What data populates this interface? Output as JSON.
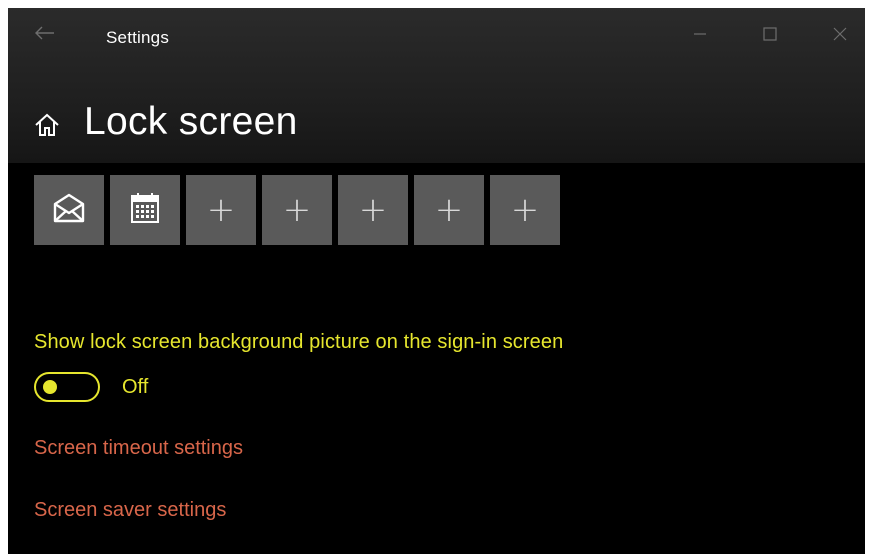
{
  "titlebar": {
    "title": "Settings",
    "back_icon": "arrow-left-icon",
    "minimize_icon": "minimize-icon",
    "maximize_icon": "maximize-icon",
    "close_icon": "close-icon"
  },
  "page": {
    "title": "Lock screen",
    "home_icon": "home-icon"
  },
  "quick_status": {
    "tiles": [
      {
        "icon": "mail-icon"
      },
      {
        "icon": "calendar-icon"
      },
      {
        "icon": "plus-icon",
        "label": "+"
      },
      {
        "icon": "plus-icon",
        "label": "+"
      },
      {
        "icon": "plus-icon",
        "label": "+"
      },
      {
        "icon": "plus-icon",
        "label": "+"
      },
      {
        "icon": "plus-icon",
        "label": "+"
      }
    ]
  },
  "signin_background": {
    "label": "Show lock screen background picture on the sign-in screen",
    "state": "Off",
    "enabled": false
  },
  "links": {
    "screen_timeout": "Screen timeout settings",
    "screen_saver": "Screen saver settings"
  },
  "colors": {
    "background": "#000000",
    "header": "#1e1e1e",
    "tile": "#5a5a5a",
    "highlight_yellow": "#e6e62e",
    "link_orange": "#d8664a",
    "text": "#ffffff"
  }
}
